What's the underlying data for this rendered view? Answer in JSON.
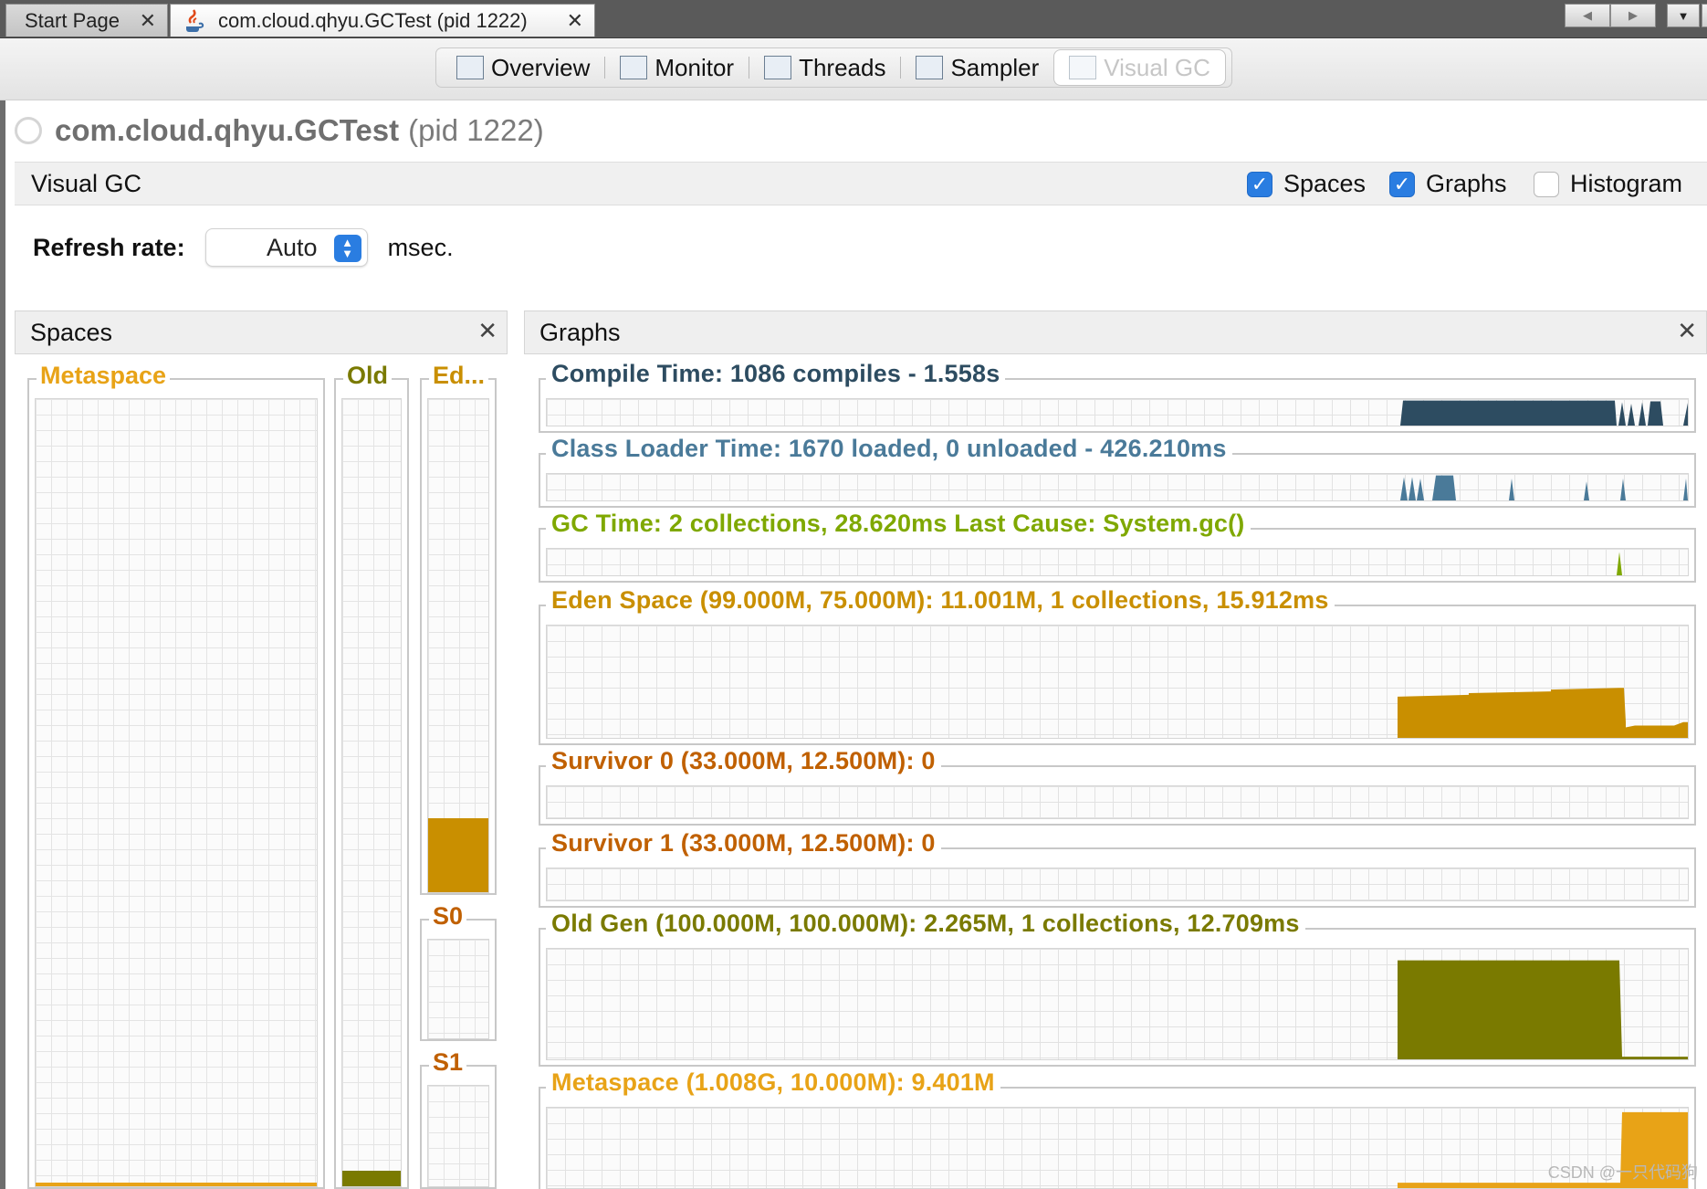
{
  "doc_tabs": {
    "start_page": "Start Page",
    "app_tab": "com.cloud.qhyu.GCTest (pid 1222)",
    "close_glyph": "✕"
  },
  "view_tabs": [
    {
      "label": "Overview",
      "icon": "overview-icon"
    },
    {
      "label": "Monitor",
      "icon": "monitor-icon"
    },
    {
      "label": "Threads",
      "icon": "threads-icon"
    },
    {
      "label": "Sampler",
      "icon": "sampler-icon"
    },
    {
      "label": "Visual GC",
      "icon": "visual-gc-icon",
      "selected": true
    }
  ],
  "header": {
    "app_name": "com.cloud.qhyu.GCTest",
    "pid": "(pid 1222)"
  },
  "visual_gc_bar": {
    "title": "Visual GC",
    "spaces_label": "Spaces",
    "spaces_checked": true,
    "graphs_label": "Graphs",
    "graphs_checked": true,
    "histogram_label": "Histogram",
    "histogram_checked": false
  },
  "refresh": {
    "label": "Refresh rate:",
    "value": "Auto",
    "unit": "msec."
  },
  "spaces_panel": {
    "title": "Spaces",
    "boxes": [
      {
        "label": "Metaspace",
        "color": "#e8a317",
        "fill_color": "#e8a317",
        "fill_fraction": 0.005
      },
      {
        "label": "Old",
        "color": "#7a7a00",
        "fill_color": "#7a7a00",
        "fill_fraction": 0.02
      },
      {
        "label": "Ed...",
        "color": "#c98f00",
        "fill_color": "#c98f00",
        "fill_fraction": 0.15
      },
      {
        "label": "S0",
        "color": "#c06000",
        "fill_color": "#c06000",
        "fill_fraction": 0
      },
      {
        "label": "S1",
        "color": "#c06000",
        "fill_color": "#c06000",
        "fill_fraction": 0
      }
    ]
  },
  "graphs_panel": {
    "title": "Graphs",
    "graphs": [
      {
        "title": "Compile Time: 1086 compiles - 1.558s",
        "color": "#2d4c61"
      },
      {
        "title": "Class Loader Time: 1670 loaded, 0 unloaded - 426.210ms",
        "color": "#4a7a99"
      },
      {
        "title": "GC Time: 2 collections, 28.620ms Last Cause: System.gc()",
        "color": "#7fa800"
      },
      {
        "title": "Eden Space (99.000M, 75.000M): 11.001M, 1 collections, 15.912ms",
        "color": "#c98f00"
      },
      {
        "title": "Survivor 0 (33.000M, 12.500M): 0",
        "color": "#c06000"
      },
      {
        "title": "Survivor 1 (33.000M, 12.500M): 0",
        "color": "#c06000"
      },
      {
        "title": "Old Gen (100.000M, 100.000M): 2.265M, 1 collections, 12.709ms",
        "color": "#7a7a00"
      },
      {
        "title": "Metaspace (1.008G, 10.000M): 9.401M",
        "color": "#e8a317"
      }
    ]
  },
  "watermark": "CSDN @一只代码狗"
}
